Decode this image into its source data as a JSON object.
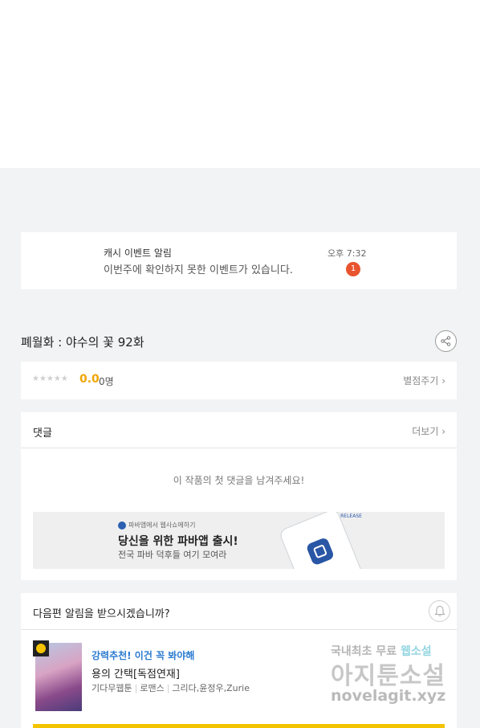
{
  "notification": {
    "title": "캐시 이벤트 알림",
    "message": "이번주에 확인하지 못한 이벤트가 있습니다.",
    "time": "오후 7:32",
    "badge": "1"
  },
  "episode": {
    "title": "폐월화 : 야수의 꽃 92화"
  },
  "rating": {
    "stars": "★★★★★",
    "score": "0.0",
    "count": "0명",
    "rate_link": "별점주기"
  },
  "comments": {
    "title": "댓글",
    "more": "더보기",
    "empty": "이 작품의 첫 댓글을 남겨주세요!",
    "banner": {
      "small": "파바앱에서 웹사쇼에하기",
      "main": "당신을 위한 파바앱 출시!",
      "sub": "전국 파바 덕후들 여기 모여라",
      "tag": "NEW RELEASE"
    }
  },
  "next_alert": {
    "title": "다음편 알림을 받으시겠습니까?",
    "recommend_tag": "강력추천! 이건 꼭 봐야해",
    "recommend_title": "용의 간택[독점연재]",
    "meta": [
      "기다무웹툰",
      "로맨스",
      "그리다,윤정우,Zurie"
    ]
  },
  "watermark": {
    "line1_a": "국내최초 무료 ",
    "line1_b": "웹소설",
    "line2": "아지툰소설",
    "line3": "novelagit.xyz"
  },
  "icons": {
    "share": "share-icon",
    "bell": "bell-icon",
    "clock": "clock-icon",
    "chevron": "chevron-right-icon"
  },
  "colors": {
    "score": "#f0a500",
    "badge": "#e8542f",
    "accent_blue": "#2a7ad0",
    "yellow": "#f5c400"
  }
}
